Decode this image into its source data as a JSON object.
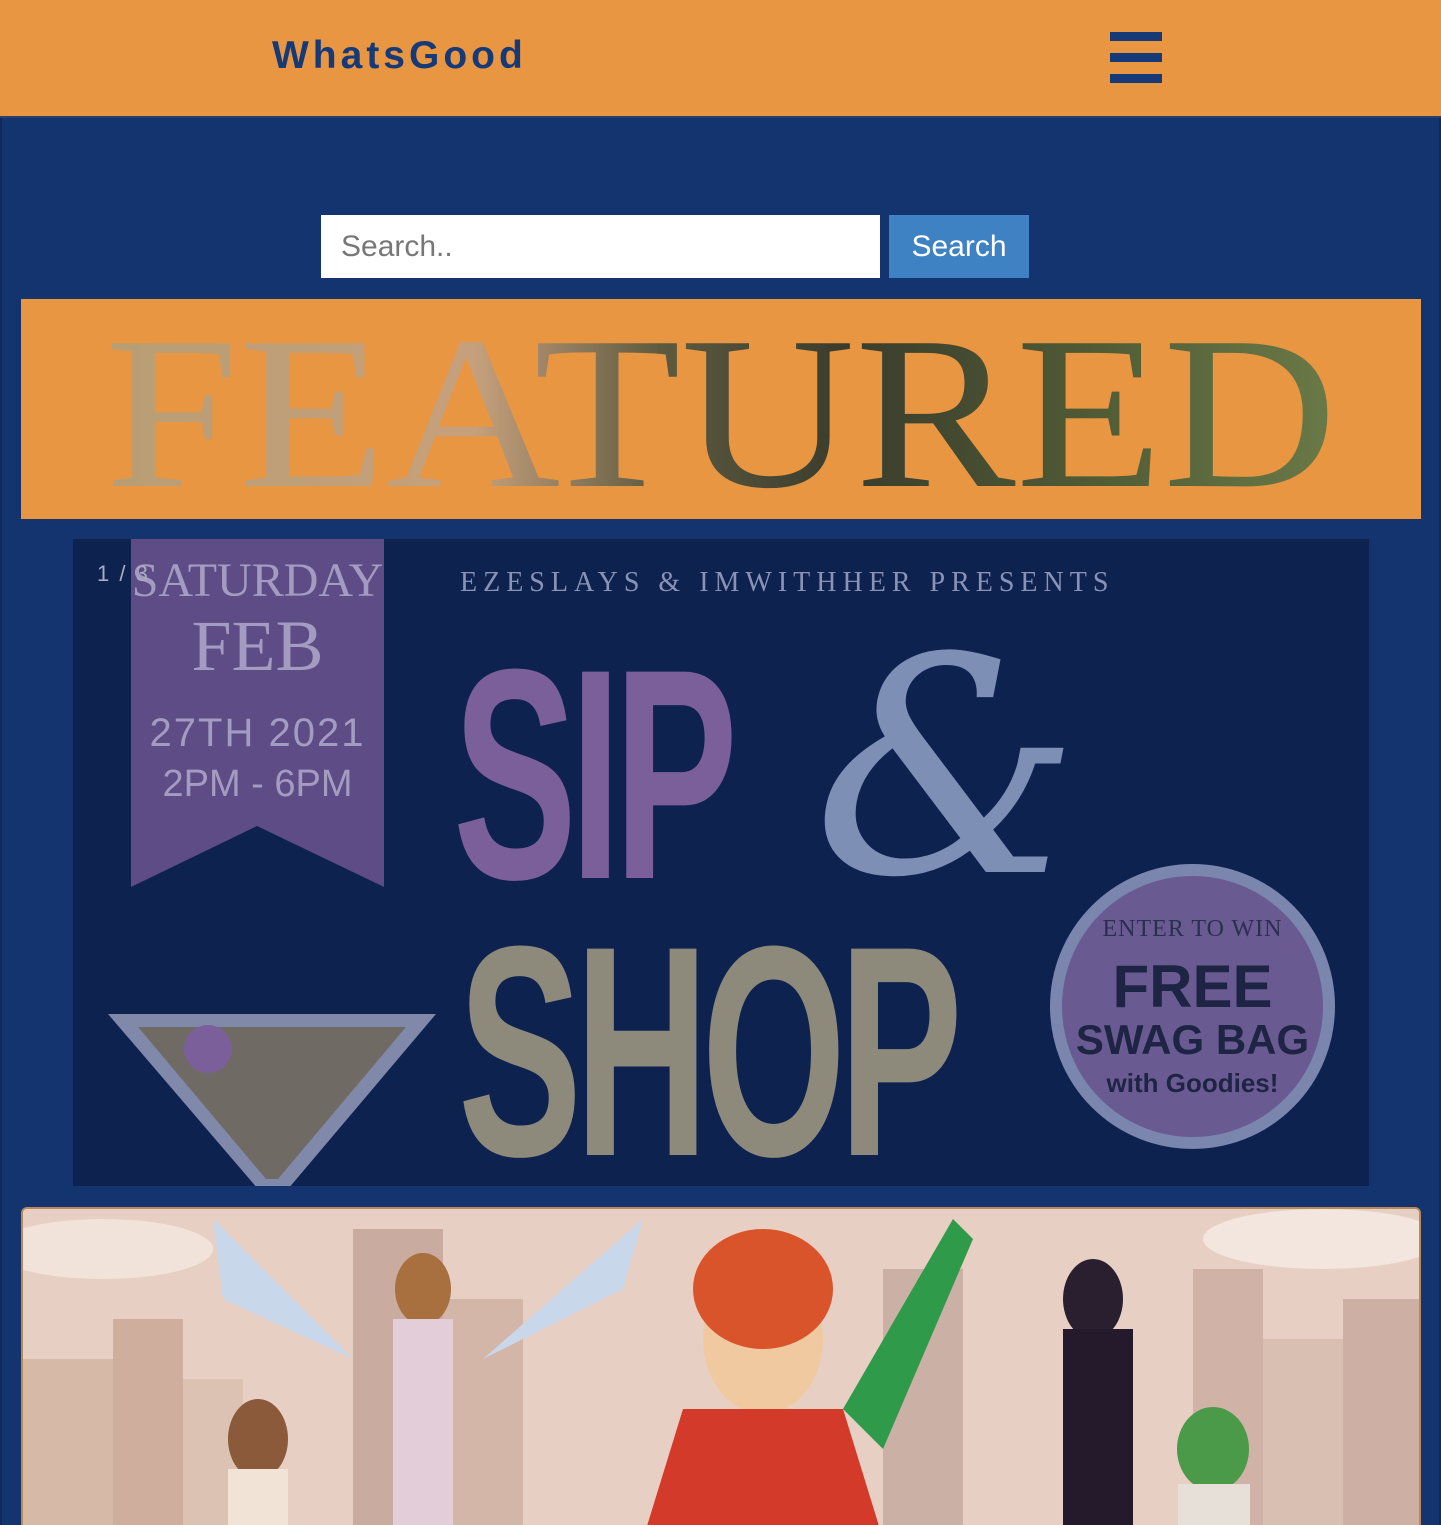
{
  "header": {
    "brand": "WhatsGood",
    "menu_icon": "hamburger-menu-icon"
  },
  "search": {
    "placeholder": "Search..",
    "button_label": "Search"
  },
  "featured": {
    "heading": "FEATURED"
  },
  "slideshow": {
    "counter": "1 / 3",
    "slide": {
      "day": "SATURDAY",
      "month": "FEB",
      "date": "27TH 2021",
      "time": "2PM - 6PM",
      "presenters": "EZESLAYS & IMWITHHER PRESENTS",
      "title_top": "SIP",
      "ampersand": "&",
      "title_bottom": "SHOP",
      "badge_line1": "ENTER TO WIN",
      "badge_line2": "FREE",
      "badge_line3": "SWAG BAG",
      "badge_line4": "with Goodies!"
    }
  },
  "colors": {
    "header_bg": "#e89642",
    "page_bg": "#13346f",
    "brand": "#163a78",
    "search_button": "#3e82c4"
  }
}
